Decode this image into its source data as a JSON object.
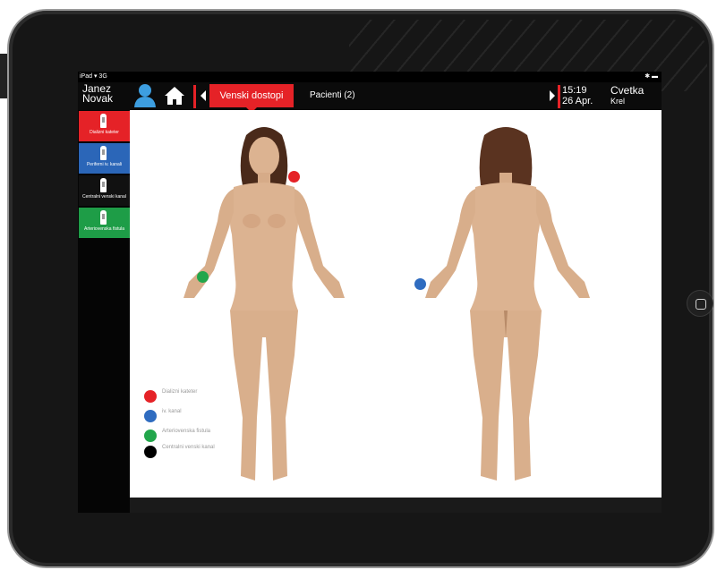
{
  "status": {
    "carrier": "iPad",
    "network": "3G"
  },
  "user": {
    "first_name": "Janez",
    "last_name": "Novak"
  },
  "nav": {
    "active_tab": "Venski dostopi",
    "second_tab": "Pacienti (2)",
    "time": "15:19",
    "date": "26 Apr.",
    "current_user_first": "Cvetka",
    "current_user_last": "Krel"
  },
  "sidebar": {
    "items": [
      {
        "label": "Dializni kateter",
        "color": "#e52227"
      },
      {
        "label": "Periferni iv. kanali",
        "color": "#2b66b8"
      },
      {
        "label": "Centralni venski kanal",
        "color": "#111111"
      },
      {
        "label": "Arteriovenska fistula",
        "color": "#1e9d47"
      }
    ]
  },
  "legend": [
    {
      "label": "Dializni kateter",
      "color": "#e52227"
    },
    {
      "label": "iv. kanal",
      "color": "#2f6cc0"
    },
    {
      "label": "Arteriovenska fistula",
      "color": "#22a64b"
    },
    {
      "label": "Centralni venski kanal",
      "color": "#000000"
    }
  ],
  "markers": {
    "neck": "#e52227",
    "front_wrist": "#22a64b",
    "back_wrist": "#2f6cc0"
  },
  "colors": {
    "accent": "#e52227",
    "skin": "#dcb391",
    "hair": "#4a2a1a"
  }
}
